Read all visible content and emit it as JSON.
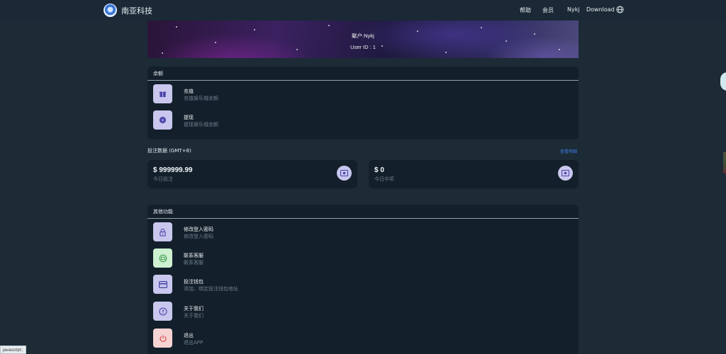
{
  "header": {
    "brand": "南亚科技",
    "nav": [
      "帮助",
      "会员",
      "Nykj",
      "Download"
    ]
  },
  "banner": {
    "account": "账户:Nykj",
    "user_id": "User ID : 1"
  },
  "balance": {
    "title": "余额",
    "items": [
      {
        "title": "充值",
        "sub": "充值娱乐城余额",
        "icon": "gift-icon"
      },
      {
        "title": "提现",
        "sub": "提现娱乐城余额",
        "icon": "yen-icon"
      }
    ]
  },
  "bets": {
    "title": "投注数据 (GMT+8)",
    "link": "查看明细",
    "stats": [
      {
        "value": "$ 999999.99",
        "label": "今日投注"
      },
      {
        "value": "$ 0",
        "label": "今日中奖"
      }
    ]
  },
  "other": {
    "title": "其他功能",
    "items": [
      {
        "title": "修改登入密码",
        "sub": "修改登入密码",
        "icon": "lock-icon"
      },
      {
        "title": "联系客服",
        "sub": "联系客服",
        "icon": "support-icon"
      },
      {
        "title": "投注钱包",
        "sub": "添加、绑定投注钱包地址",
        "icon": "wallet-icon"
      },
      {
        "title": "关于我们",
        "sub": "关于我们",
        "icon": "info-icon"
      },
      {
        "title": "退出",
        "sub": "退出APP",
        "icon": "power-icon"
      }
    ]
  },
  "status_tip": "javascript:;",
  "colors": {
    "background": "#1c2b36",
    "card": "#13202b",
    "icon_purple": "#c9c7ee",
    "icon_green": "#cdf1d0",
    "icon_pink": "#f5d3d3",
    "link": "#3d7be0"
  }
}
